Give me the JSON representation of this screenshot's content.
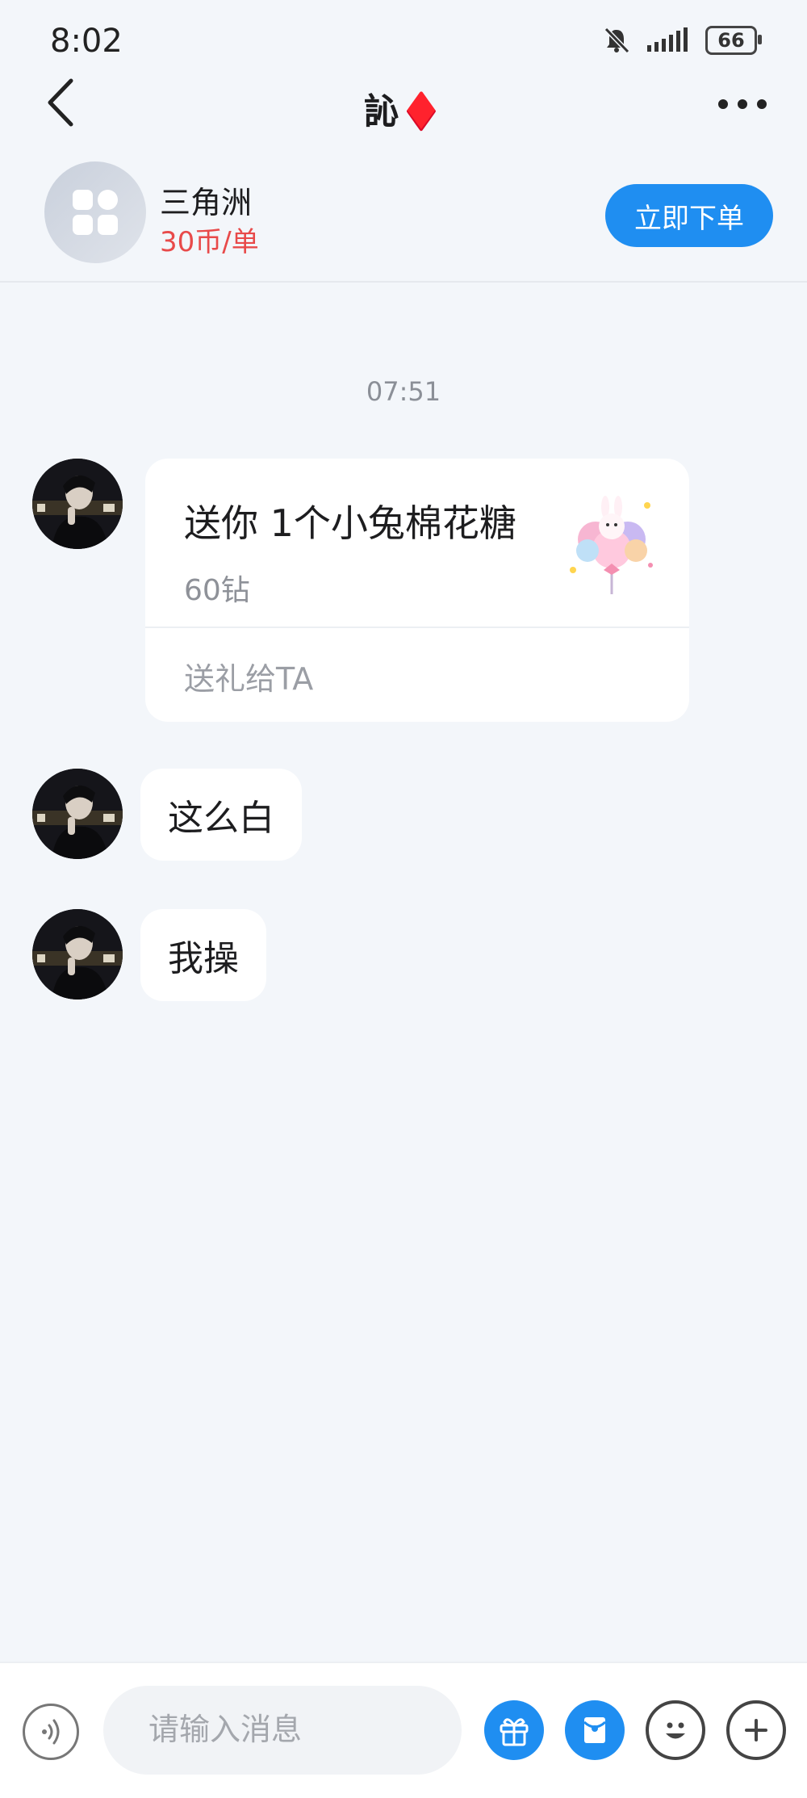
{
  "status": {
    "time": "8:02",
    "battery": "66"
  },
  "header": {
    "title": "訫♦️"
  },
  "product": {
    "name": "三角洲",
    "price": "30币/单",
    "order_label": "立即下单"
  },
  "chat": {
    "timestamp": "07:51",
    "gift": {
      "title": "送你 1个小兔棉花糖",
      "price": "60钻",
      "send_label": "送礼给TA"
    },
    "messages": [
      {
        "text": "这么白"
      },
      {
        "text": "我操"
      }
    ]
  },
  "input": {
    "placeholder": "请输入消息"
  },
  "colors": {
    "accent": "#1f8ef1",
    "price": "#e84a4a",
    "background": "#f3f6fa"
  }
}
